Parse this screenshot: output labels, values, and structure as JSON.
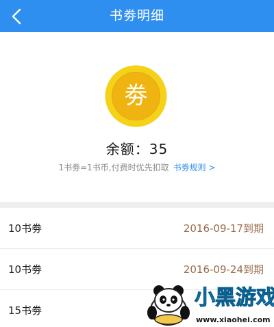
{
  "header": {
    "title": "书劵明细",
    "back_icon": "chevron-left-icon",
    "background_color": "#2f8ff0"
  },
  "summary": {
    "coin_icon": "coupon-coin-icon",
    "coin_char": "劵",
    "balance_label": "余额：",
    "balance_value": "35",
    "note": "1书劵=1书币,付费时优先扣取",
    "rules_link": "书劵规则 >"
  },
  "coupons": [
    {
      "label": "10书劵",
      "expiry": "2016-09-17到期"
    },
    {
      "label": "10书劵",
      "expiry": "2016-09-24到期"
    },
    {
      "label": "15书劵",
      "expiry": ""
    }
  ],
  "watermark": {
    "brand_text": "小黑游戏",
    "url_text": "www.xiaohei.com"
  }
}
